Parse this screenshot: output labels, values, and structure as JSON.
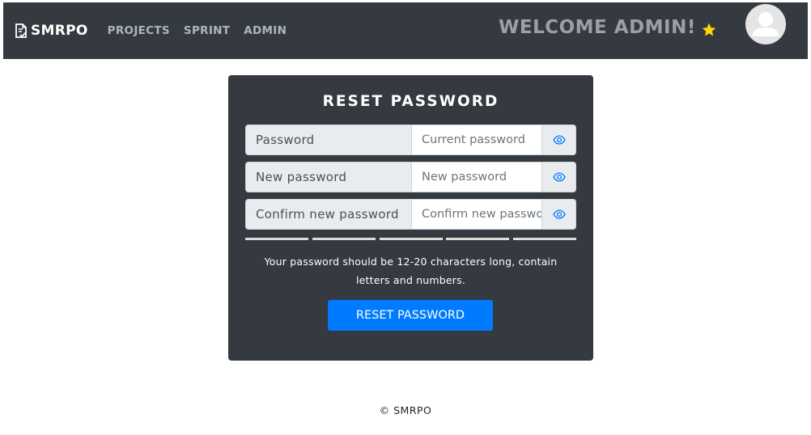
{
  "navbar": {
    "brand": "SMRPO",
    "brand_icon": "document-check-icon",
    "links": [
      "PROJECTS",
      "SPRINT",
      "ADMIN"
    ],
    "welcome": "WELCOME ADMIN!",
    "star_icon": "star-icon",
    "star_color": "#ffd700",
    "avatar_icon": "user-avatar-icon",
    "bg_color": "#343a40"
  },
  "form": {
    "title": "RESET PASSWORD",
    "rows": [
      {
        "label": "Password",
        "placeholder": "Current password",
        "value": ""
      },
      {
        "label": "New password",
        "placeholder": "New password",
        "value": ""
      },
      {
        "label": "Confirm new password",
        "placeholder": "Confirm new password",
        "value": ""
      }
    ],
    "eye_icon": "eye-icon",
    "eye_color": "#007bff",
    "strength_segments": 5,
    "strength_filled": 0,
    "hint_line1": "Your password should be 12-20 characters long, contain",
    "hint_line2": "letters and numbers.",
    "submit_label": "RESET PASSWORD",
    "submit_color": "#007bff"
  },
  "footer": {
    "text": "© SMRPO"
  }
}
